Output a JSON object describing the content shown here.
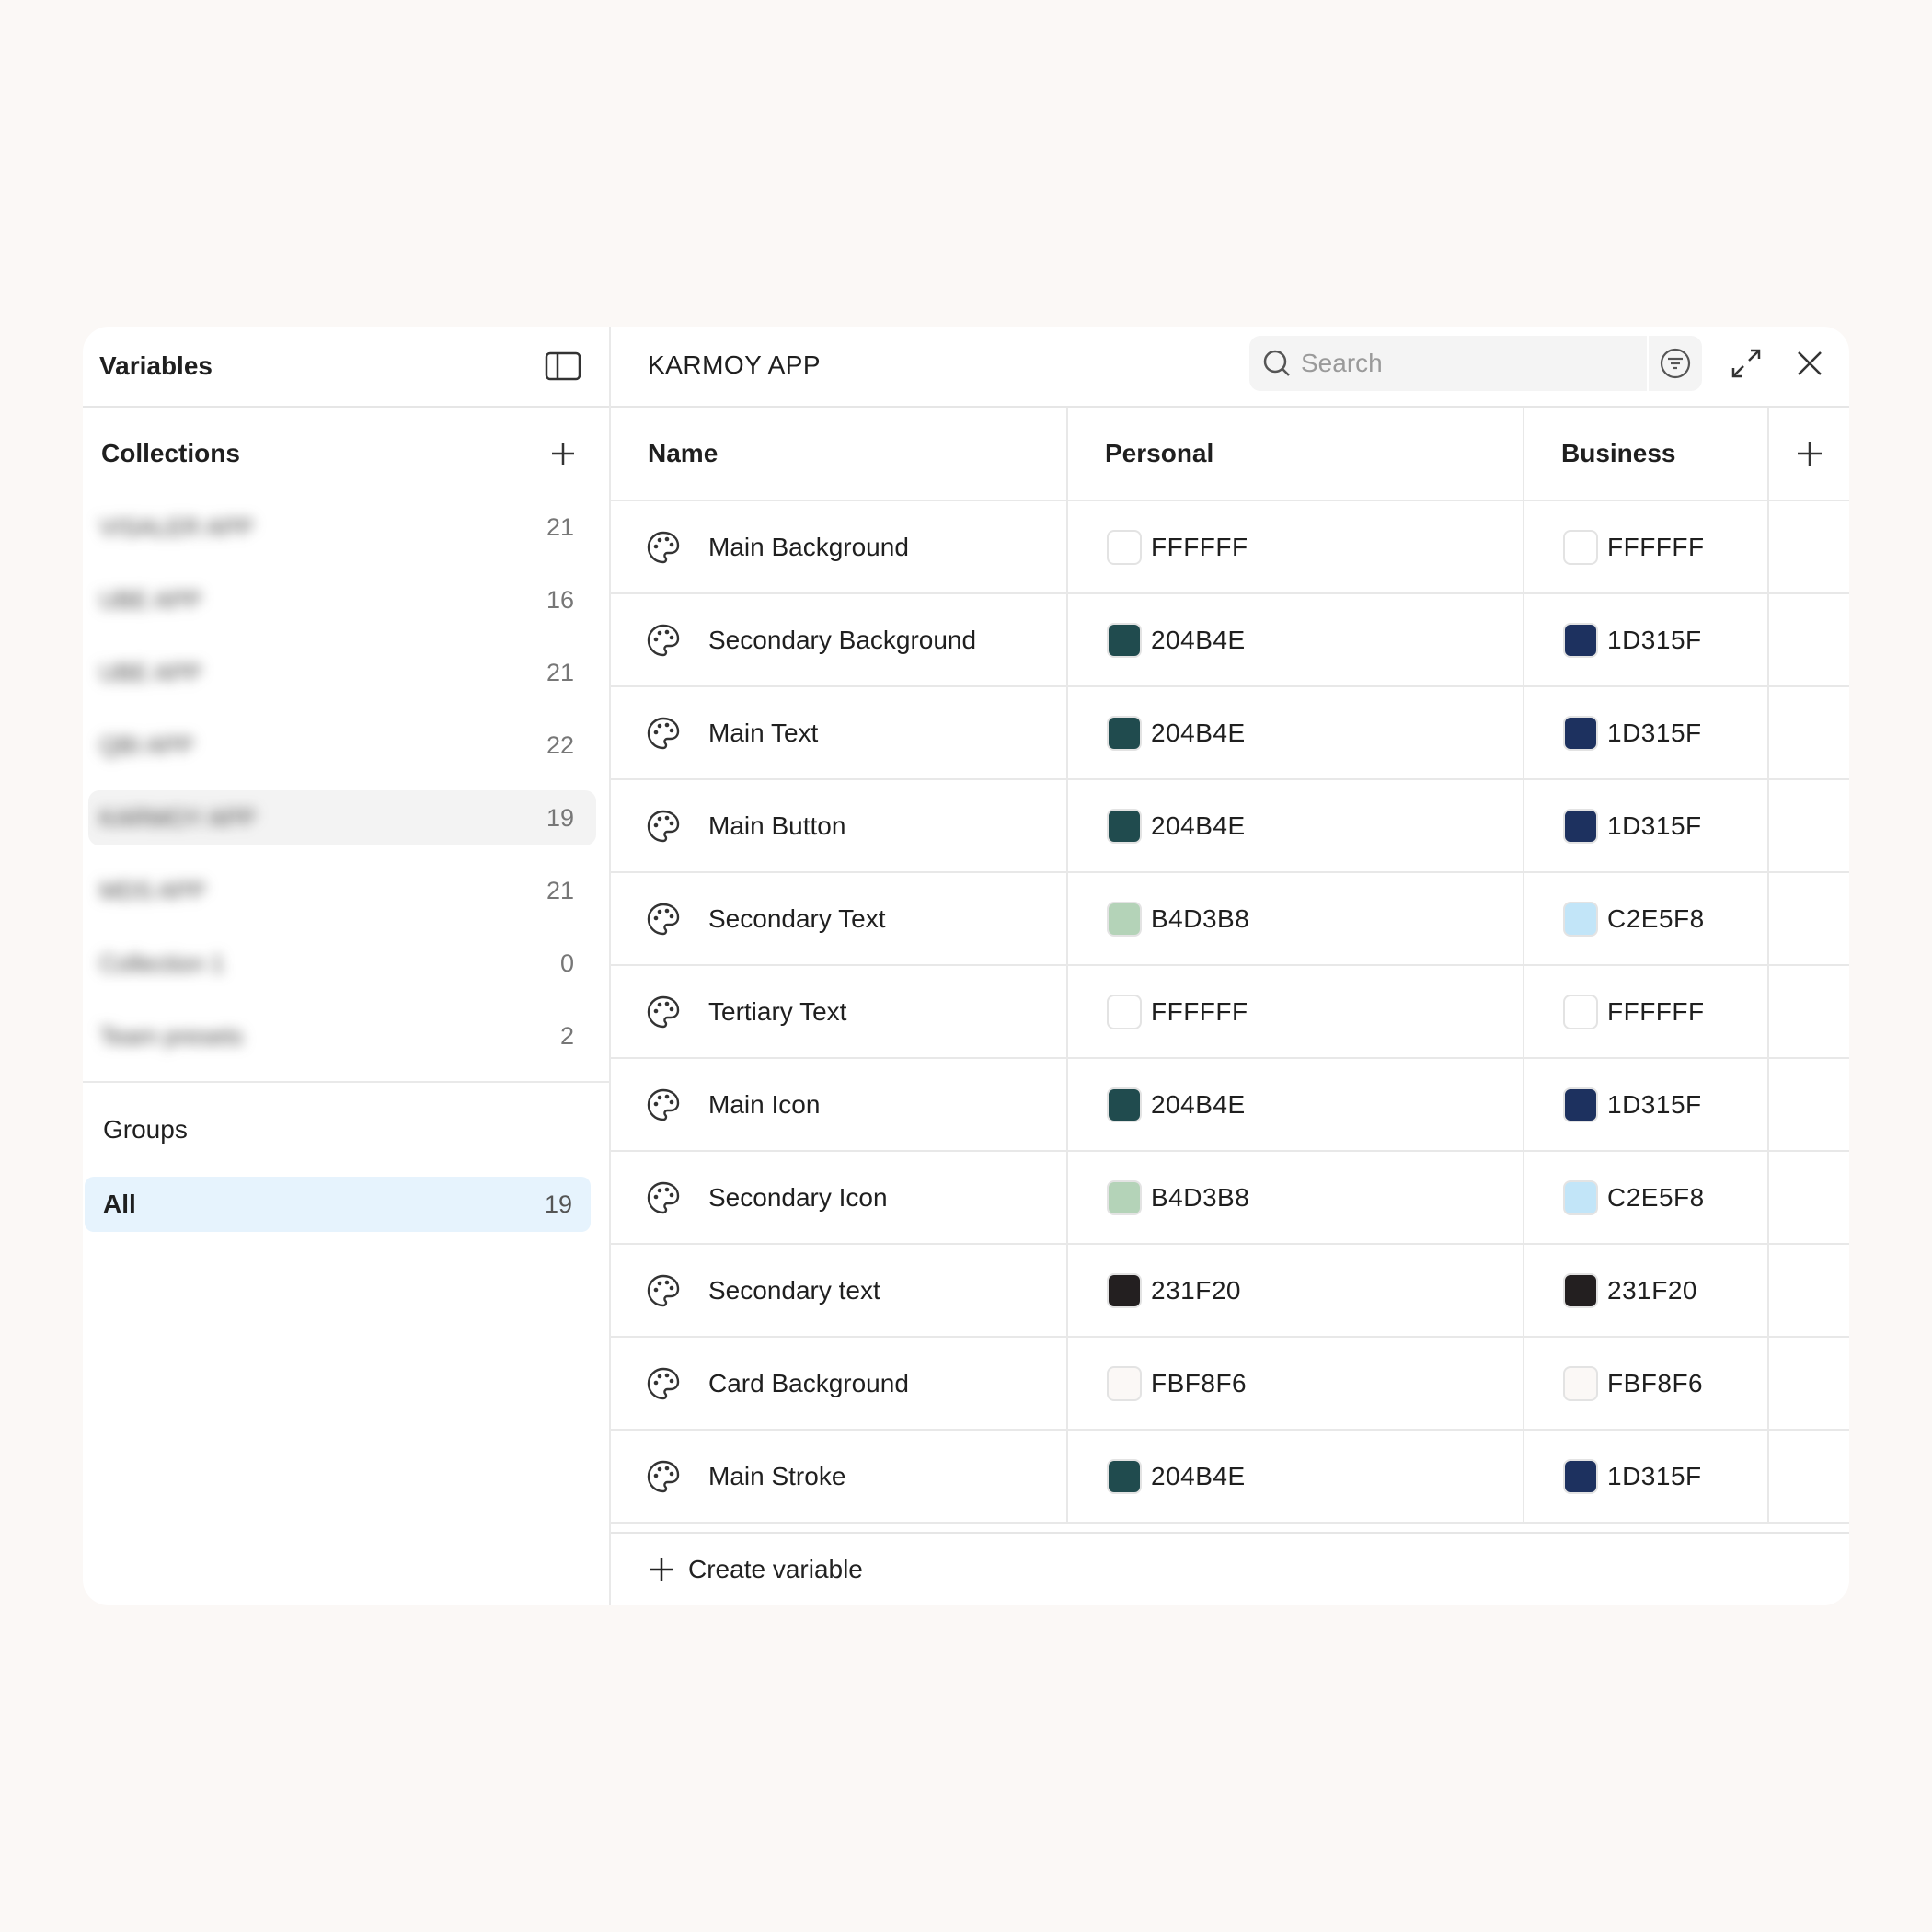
{
  "sidebar": {
    "title": "Variables",
    "collections_title": "Collections",
    "collections": [
      {
        "name": "VISALER APP",
        "count": "21"
      },
      {
        "name": "UBE APP",
        "count": "16"
      },
      {
        "name": "UBE APP",
        "count": "21"
      },
      {
        "name": "QBI APP",
        "count": "22"
      },
      {
        "name": "KARMOY APP",
        "count": "19",
        "selected": true
      },
      {
        "name": "MDS APP",
        "count": "21"
      },
      {
        "name": "Collection 1",
        "count": "0"
      },
      {
        "name": "Team presets",
        "count": "2"
      }
    ],
    "groups_title": "Groups",
    "groups": [
      {
        "label": "All",
        "count": "19"
      }
    ]
  },
  "main": {
    "collection_title": "KARMOY APP",
    "search_placeholder": "Search",
    "columns": {
      "name": "Name",
      "personal": "Personal",
      "business": "Business"
    },
    "create_label": "Create variable"
  },
  "variables": [
    {
      "name": "Main Background",
      "personal": "FFFFFF",
      "personal_color": "#FFFFFF",
      "business": "FFFFFF",
      "business_color": "#FFFFFF"
    },
    {
      "name": "Secondary Background",
      "personal": "204B4E",
      "personal_color": "#204B4E",
      "business": "1D315F",
      "business_color": "#1D315F"
    },
    {
      "name": "Main Text",
      "personal": "204B4E",
      "personal_color": "#204B4E",
      "business": "1D315F",
      "business_color": "#1D315F"
    },
    {
      "name": "Main Button",
      "personal": "204B4E",
      "personal_color": "#204B4E",
      "business": "1D315F",
      "business_color": "#1D315F"
    },
    {
      "name": "Secondary Text",
      "personal": "B4D3B8",
      "personal_color": "#B4D3B8",
      "business": "C2E5F8",
      "business_color": "#C2E5F8"
    },
    {
      "name": "Tertiary Text",
      "personal": "FFFFFF",
      "personal_color": "#FFFFFF",
      "business": "FFFFFF",
      "business_color": "#FFFFFF"
    },
    {
      "name": "Main Icon",
      "personal": "204B4E",
      "personal_color": "#204B4E",
      "business": "1D315F",
      "business_color": "#1D315F"
    },
    {
      "name": "Secondary Icon",
      "personal": "B4D3B8",
      "personal_color": "#B4D3B8",
      "business": "C2E5F8",
      "business_color": "#C2E5F8"
    },
    {
      "name": "Secondary text",
      "personal": "231F20",
      "personal_color": "#231F20",
      "business": "231F20",
      "business_color": "#231F20"
    },
    {
      "name": "Card Background",
      "personal": "FBF8F6",
      "personal_color": "#FBF8F6",
      "business": "FBF8F6",
      "business_color": "#FBF8F6"
    },
    {
      "name": "Main Stroke",
      "personal": "204B4E",
      "personal_color": "#204B4E",
      "business": "1D315F",
      "business_color": "#1D315F"
    }
  ],
  "icons": {
    "sidebar_toggle": "sidebar-toggle-icon",
    "add": "plus-icon",
    "search": "search-icon",
    "filter": "filter-icon",
    "expand": "expand-icon",
    "close": "close-icon",
    "variable_type": "palette-icon"
  },
  "colors": {
    "background": "#FBF8F6",
    "selected_group": "#E6F3FD"
  }
}
